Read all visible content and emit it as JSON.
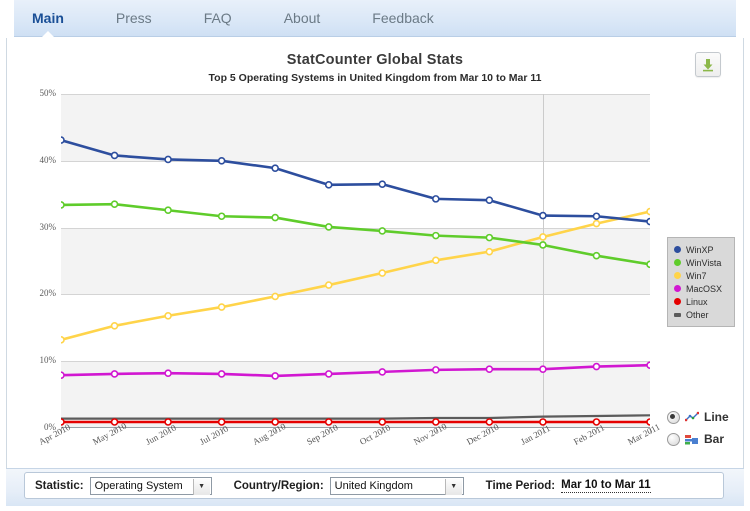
{
  "nav": {
    "tabs": [
      {
        "label": "Main",
        "active": true
      },
      {
        "label": "Press",
        "active": false
      },
      {
        "label": "FAQ",
        "active": false
      },
      {
        "label": "About",
        "active": false
      },
      {
        "label": "Feedback",
        "active": false
      }
    ]
  },
  "header": {
    "title": "StatCounter Global Stats",
    "subtitle": "Top 5 Operating Systems in United Kingdom from Mar 10 to Mar 11",
    "download_icon": "download-icon"
  },
  "chart_type": {
    "options": [
      {
        "label": "Line",
        "selected": true,
        "icon": "line-chart-icon"
      },
      {
        "label": "Bar",
        "selected": false,
        "icon": "bar-chart-icon"
      }
    ]
  },
  "controls": {
    "statistic_label": "Statistic:",
    "statistic_value": "Operating System",
    "country_label": "Country/Region:",
    "country_value": "United Kingdom",
    "time_period_label": "Time Period:",
    "time_period_value": "Mar 10 to Mar 11",
    "dropdown_arrow": "▼"
  },
  "chart_data": {
    "type": "line",
    "title": "StatCounter Global Stats",
    "subtitle": "Top 5 Operating Systems in United Kingdom from Mar 10 to Mar 11",
    "xlabel": "",
    "ylabel": "",
    "ylim": [
      0,
      50
    ],
    "yticks": [
      0,
      10,
      20,
      30,
      40,
      50
    ],
    "ytick_labels": [
      "0%",
      "10%",
      "20%",
      "30%",
      "40%",
      "50%"
    ],
    "grid": true,
    "legend_position": "right",
    "categories": [
      "Apr 2010",
      "May 2010",
      "Jun 2010",
      "Jul 2010",
      "Aug 2010",
      "Sep 2010",
      "Oct 2010",
      "Nov 2010",
      "Dec 2010",
      "Jan 2011",
      "Feb 2011",
      "Mar 2011"
    ],
    "series": [
      {
        "name": "WinXP",
        "color": "#2d4e9e",
        "values": [
          43.1,
          40.8,
          40.2,
          40.0,
          38.9,
          36.4,
          36.5,
          34.3,
          34.1,
          31.8,
          31.7,
          30.9
        ]
      },
      {
        "name": "WinVista",
        "color": "#5fcc2b",
        "values": [
          33.4,
          33.5,
          32.6,
          31.7,
          31.5,
          30.1,
          29.5,
          28.8,
          28.5,
          27.4,
          25.8,
          24.5
        ]
      },
      {
        "name": "Win7",
        "color": "#ffd44a",
        "values": [
          13.2,
          15.3,
          16.8,
          18.1,
          19.7,
          21.4,
          23.2,
          25.1,
          26.4,
          28.6,
          30.6,
          32.4
        ]
      },
      {
        "name": "MacOSX",
        "color": "#d117d1",
        "values": [
          7.9,
          8.1,
          8.2,
          8.1,
          7.8,
          8.1,
          8.4,
          8.7,
          8.8,
          8.8,
          9.2,
          9.4
        ]
      },
      {
        "name": "Linux",
        "color": "#e50000",
        "values": [
          0.9,
          0.9,
          0.9,
          0.9,
          0.9,
          0.9,
          0.9,
          0.9,
          0.9,
          0.9,
          0.9,
          0.9
        ]
      },
      {
        "name": "Other",
        "color": "#5b5b5b",
        "values": [
          1.4,
          1.4,
          1.4,
          1.4,
          1.4,
          1.4,
          1.4,
          1.5,
          1.5,
          1.7,
          1.8,
          1.9
        ]
      }
    ],
    "vertical_marker": "Jan 2011"
  }
}
